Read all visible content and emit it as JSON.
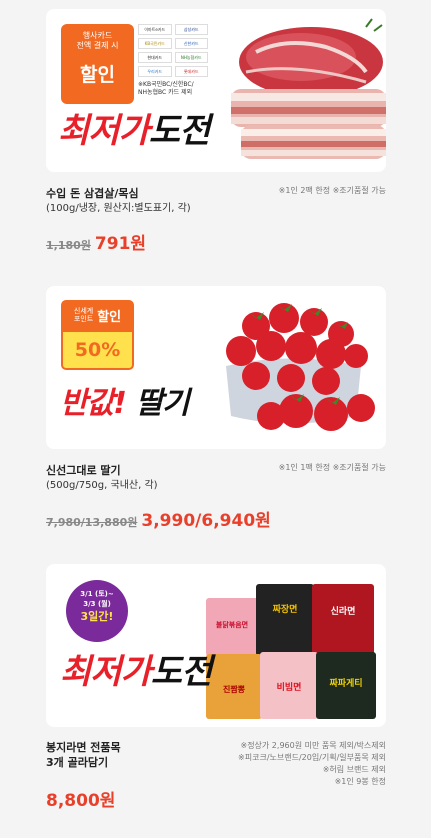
{
  "cards": [
    {
      "badge": {
        "top_text": "행사카드\n전액 결제 시",
        "main": "할인",
        "card_logos": [
          "이마트e카드",
          "삼성카드",
          "KB국민카드",
          "신한카드",
          "현대카드",
          "NH농협카드",
          "우리카드",
          "롯데카드"
        ],
        "exclusion": "※KB국민BC/신한BC/\nNH농협BC 카드 제외"
      },
      "headline_red": "최저가",
      "headline_black": "도전",
      "name": "수입 돈 삼겹살/목심",
      "spec": "(100g/냉장, 원산지:별도표기, 각)",
      "note": "※1인 2팩 한정 ※조기품절 가능",
      "old_price": "1,180원",
      "new_price": "791원"
    },
    {
      "badge": {
        "top_text": "신세계\n포인트",
        "main": "할인",
        "percent": "50%"
      },
      "headline_red": "반값!",
      "headline_black": "딸기",
      "name": "신선그대로 딸기",
      "spec": "(500g/750g, 국내산, 각)",
      "note": "※1인 1팩 한정 ※조기품절 가능",
      "old_price": "7,980/13,880원",
      "new_price": "3,990/6,940원"
    },
    {
      "badge": {
        "line1": "3/1 (토)~",
        "line2": "3/3 (월)",
        "line3": "3일간!"
      },
      "headline_red": "최저가",
      "headline_black": "도전",
      "name": "봉지라면 전품목",
      "name2": "3개 골라담기",
      "notes": [
        "※정상가 2,960원 미만 품목 제외/박스제외",
        "※피코크/노브랜드/20입/기획/일부품목 제외",
        "※허림 브랜드 제외",
        "※1인 9봉 한정"
      ],
      "new_price": "8,800원",
      "packs": [
        "불닭볶음면",
        "짜장면",
        "신라면",
        "진짬뽕",
        "비빔면",
        "짜파게티"
      ]
    }
  ],
  "colors": {
    "accent": "#e8402a",
    "badge": "#f26a21",
    "bg": "#f4f4f4"
  }
}
